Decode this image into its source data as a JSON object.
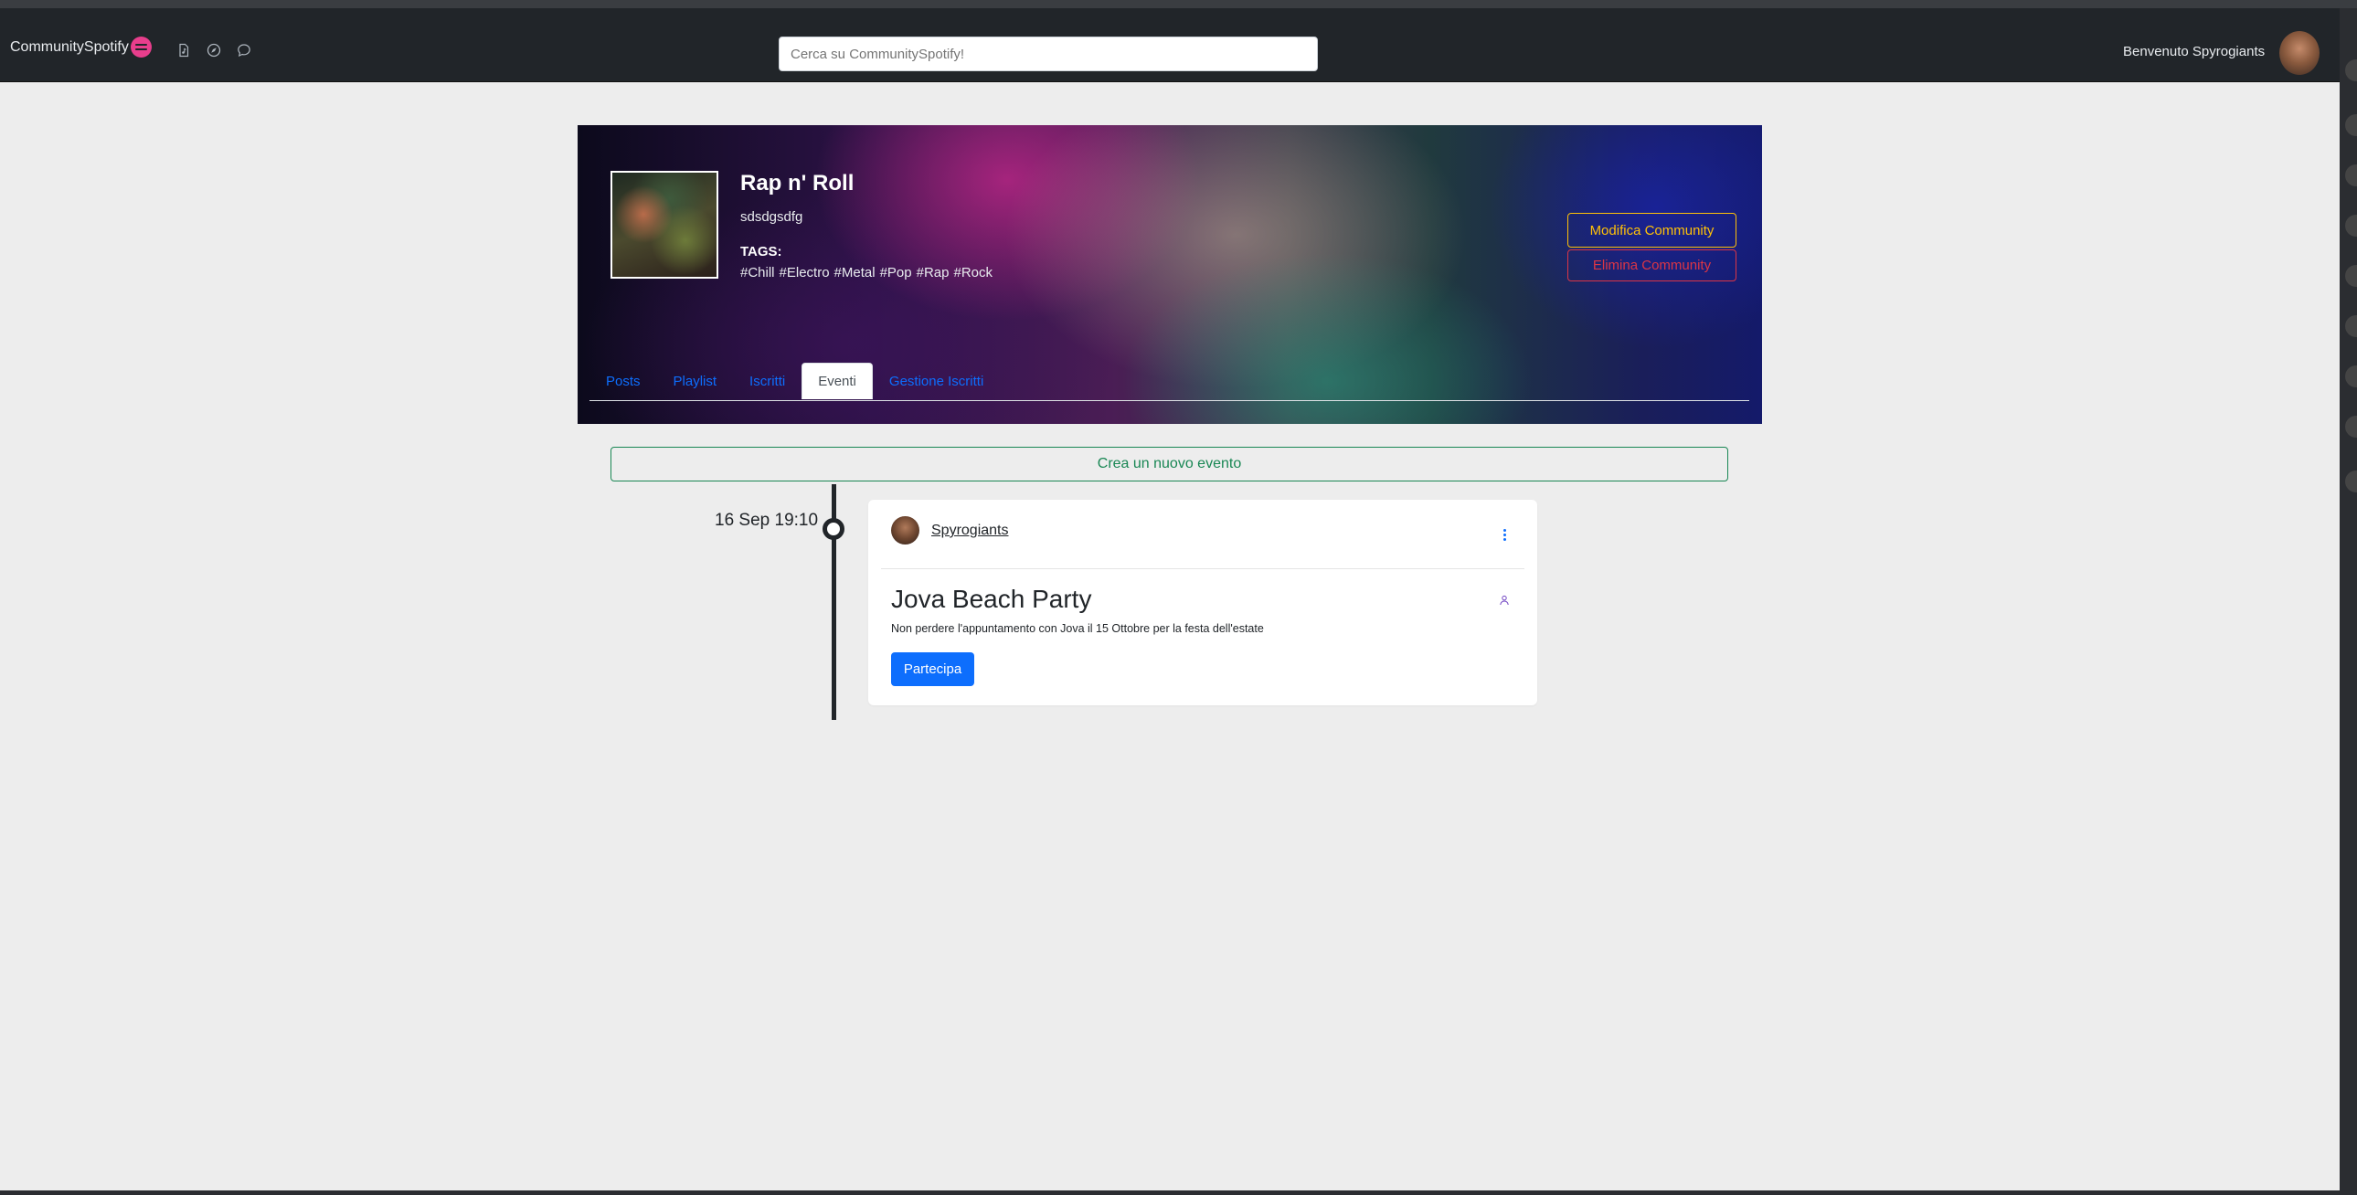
{
  "navbar": {
    "brand": "CommunitySpotify",
    "icons": [
      "file-music-icon",
      "compass-icon",
      "chat-icon"
    ],
    "search_placeholder": "Cerca su CommunitySpotify!",
    "welcome": "Benvenuto Spyrogiants"
  },
  "community": {
    "name": "Rap n' Roll",
    "description": "sdsdgsdfg",
    "tags_label": "TAGS:",
    "tags": [
      "#Chill",
      "#Electro",
      "#Metal",
      "#Pop",
      "#Rap",
      "#Rock"
    ],
    "edit_label": "Modifica Community",
    "delete_label": "Elimina Community"
  },
  "tabs": [
    {
      "label": "Posts",
      "active": false
    },
    {
      "label": "Playlist",
      "active": false
    },
    {
      "label": "Iscritti",
      "active": false
    },
    {
      "label": "Eventi",
      "active": true
    },
    {
      "label": "Gestione Iscritti",
      "active": false
    }
  ],
  "create_event_label": "Crea un nuovo evento",
  "events": [
    {
      "date": "16 Sep 19:10",
      "author": "Spyrogiants",
      "title": "Jova Beach Party",
      "description": "Non perdere l'appuntamento con Jova il 15 Ottobre per la festa dell'estate",
      "join_label": "Partecipa"
    }
  ],
  "colors": {
    "navbar": "#212529",
    "accent": "#0d6efd",
    "edit": "#ffc107",
    "delete": "#dc3545",
    "create": "#198754",
    "brand_logo": "#e83e8c"
  }
}
